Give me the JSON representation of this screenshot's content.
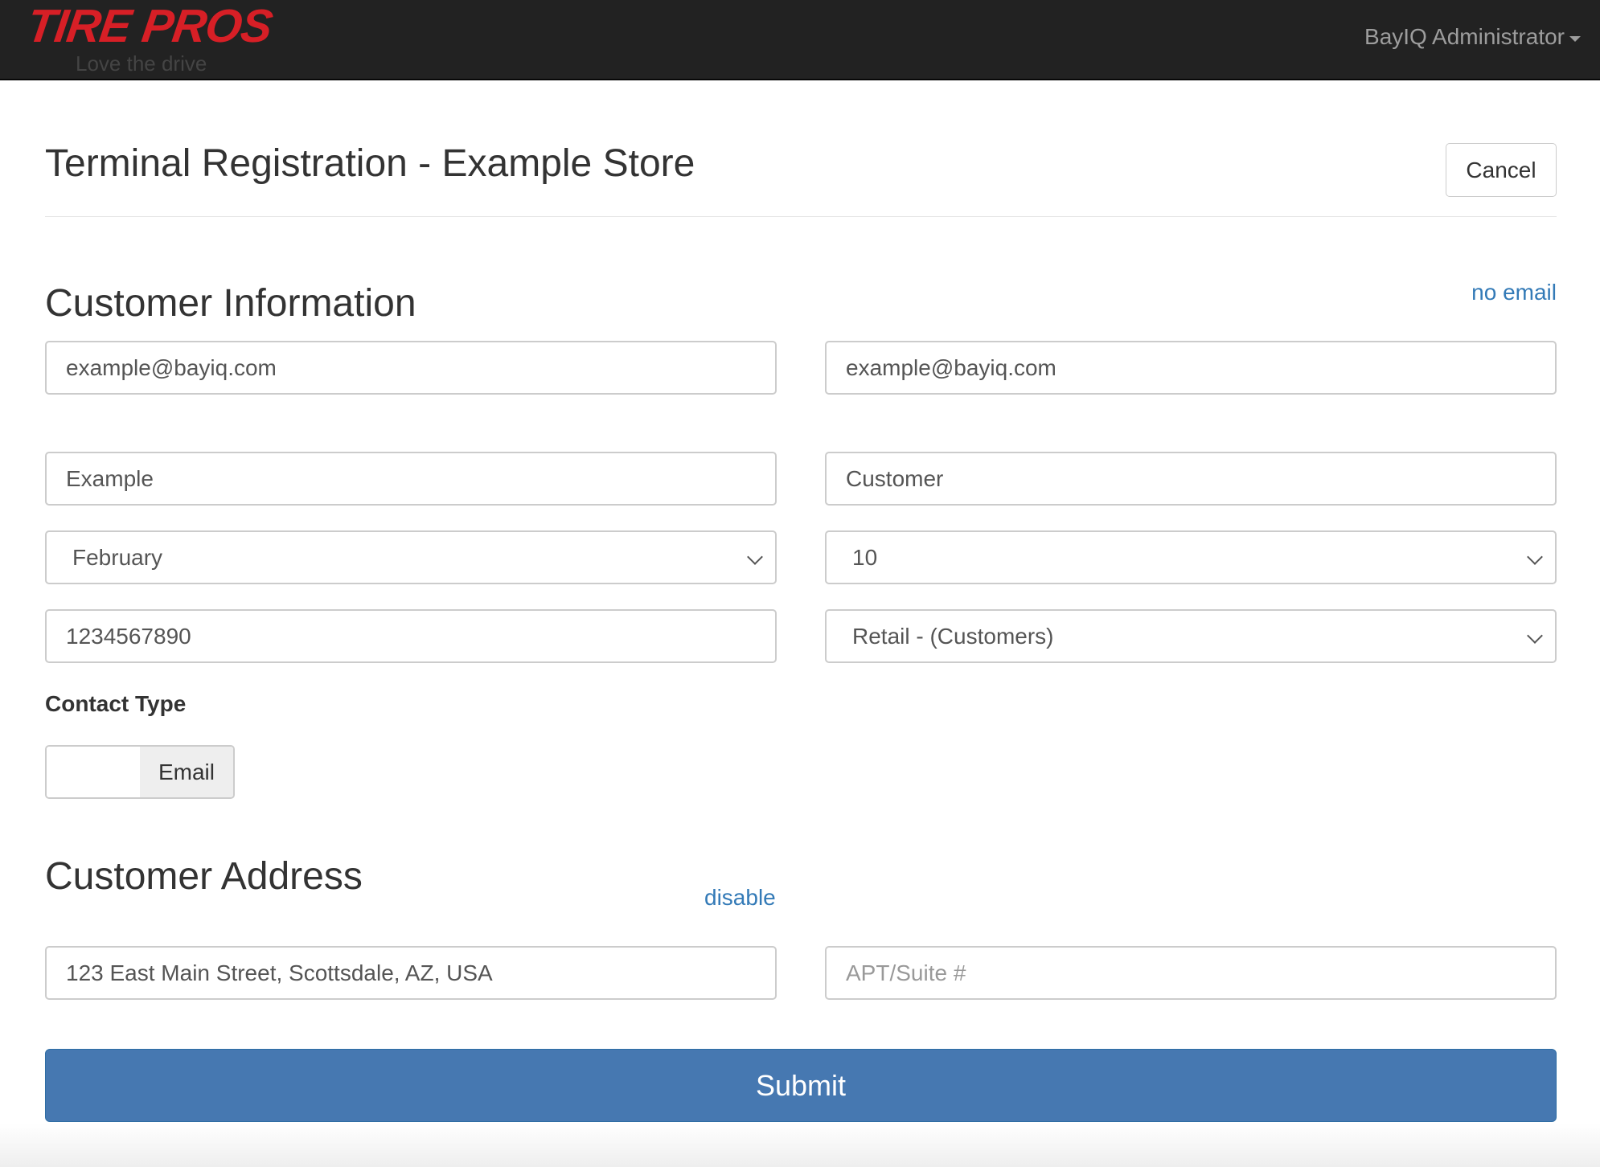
{
  "navbar": {
    "brand": "TIRE PROS",
    "tagline": "Love the drive",
    "user": "BayIQ Administrator"
  },
  "header": {
    "title": "Terminal Registration - Example Store",
    "cancel_label": "Cancel"
  },
  "customer_info": {
    "heading": "Customer Information",
    "no_email_link": "no email",
    "email": "example@bayiq.com",
    "email_confirm": "example@bayiq.com",
    "first_name": "Example",
    "last_name": "Customer",
    "birth_month": "February",
    "birth_day": "10",
    "phone": "1234567890",
    "customer_type": "Retail - (Customers)",
    "contact_type_label": "Contact Type",
    "contact_type_value": "Email"
  },
  "customer_address": {
    "heading": "Customer Address",
    "disable_link": "disable",
    "address": "123 East Main Street, Scottsdale, AZ, USA",
    "apt_placeholder": "APT/Suite #"
  },
  "submit_label": "Submit"
}
